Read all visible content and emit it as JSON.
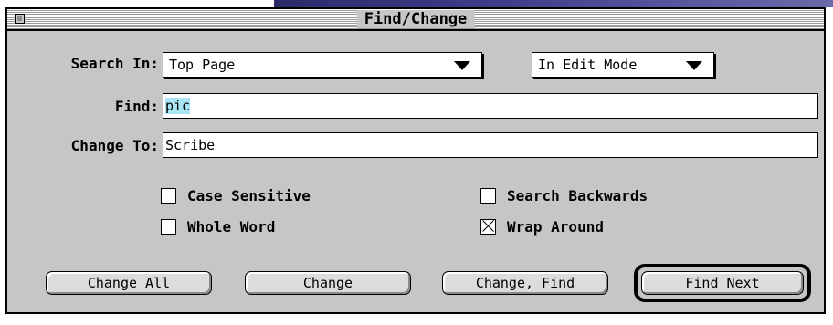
{
  "window": {
    "title": "Find/Change"
  },
  "search_in": {
    "label": "Search In:",
    "scope_value": "Top Page",
    "mode_value": "In Edit Mode"
  },
  "find": {
    "label": "Find:",
    "value": "pic"
  },
  "change_to": {
    "label": "Change To:",
    "value": "Scribe"
  },
  "options": {
    "case_sensitive": {
      "label": "Case Sensitive",
      "checked": false
    },
    "whole_word": {
      "label": "Whole Word",
      "checked": false
    },
    "search_backwards": {
      "label": "Search Backwards",
      "checked": false
    },
    "wrap_around": {
      "label": "Wrap Around",
      "checked": true
    }
  },
  "buttons": {
    "change_all": "Change All",
    "change": "Change",
    "change_find": "Change, Find",
    "find_next": "Find Next"
  },
  "colors": {
    "selection": "#a8e6f6",
    "window_bg": "#c6c6c6"
  },
  "icons": {
    "close_box": "close-box-icon",
    "popup_arrow": "triangle-down-icon",
    "checkbox_x": "checkbox-x-icon"
  }
}
